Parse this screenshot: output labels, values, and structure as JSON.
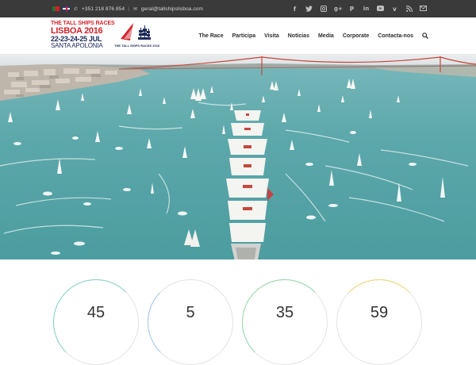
{
  "topbar": {
    "phone": "+351 218 876 854",
    "separator": "|",
    "email": "geral@tallshipslisboa.com",
    "languages": [
      "pt",
      "en"
    ],
    "social_icons": [
      "facebook-icon",
      "twitter-icon",
      "instagram-icon",
      "google-plus-icon",
      "pinterest-icon",
      "linkedin-icon",
      "youtube-icon",
      "vimeo-icon",
      "rss-icon",
      "mail-icon"
    ]
  },
  "logo": {
    "line1": "THE TALL SHIPS RACES",
    "line2": "LISBOA 2016",
    "line3": "22-23-24-25 JUL",
    "line4": "SANTA APOLÓNIA",
    "line5": "THE TALL SHIPS RACES 2016"
  },
  "nav": {
    "items": [
      "The Race",
      "Participa",
      "Visita",
      "Notícias",
      "Media",
      "Corporate",
      "Contacta-nos"
    ],
    "search_icon": "search-icon"
  },
  "stats": [
    {
      "value": "45",
      "arc_color": "#7fd1c8"
    },
    {
      "value": "5",
      "arc_color": "#9fc4e8"
    },
    {
      "value": "35",
      "arc_color": "#8fd6a8"
    },
    {
      "value": "59",
      "arc_color": "#e8d76a"
    }
  ],
  "colors": {
    "brand_red": "#d3232b",
    "brand_navy": "#1b2a5a",
    "topbar_bg": "#3a3a3a",
    "water": "#4fa3a5"
  }
}
